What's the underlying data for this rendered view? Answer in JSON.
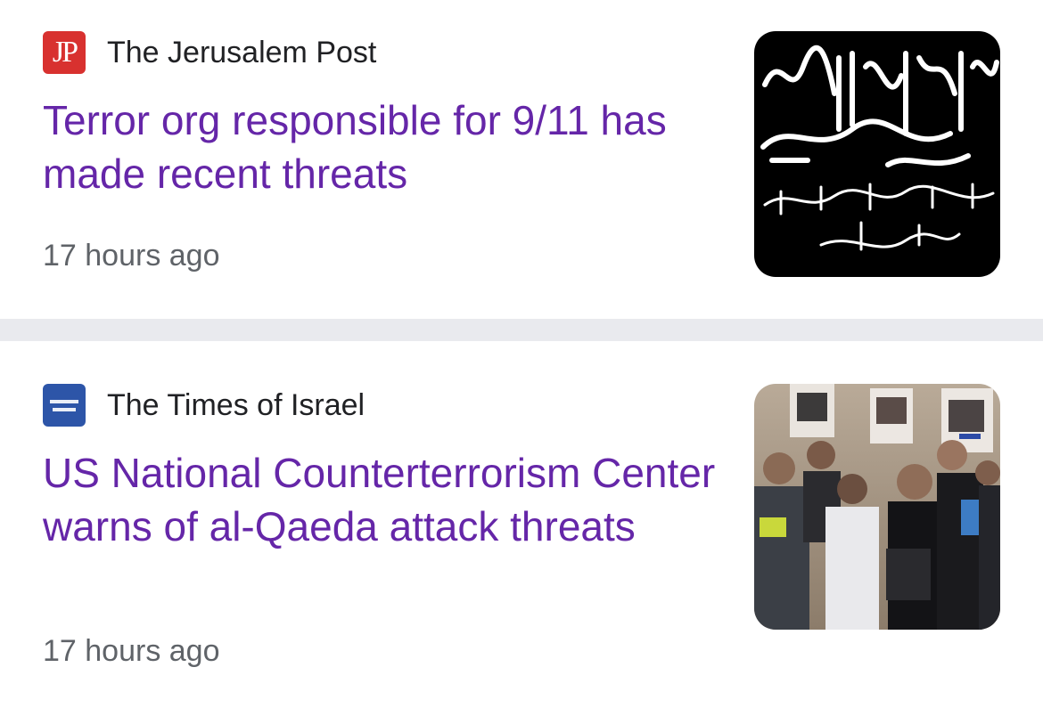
{
  "articles": [
    {
      "source": "The Jerusalem Post",
      "source_logo_text": "JP",
      "source_logo_color": "#d8312f",
      "headline": "Terror org responsible for 9/11 has made recent threats",
      "time": "17 hours ago",
      "thumbnail": "black-banner-arabic-script"
    },
    {
      "source": "The Times of Israel",
      "source_logo_color": "#2d55a8",
      "headline": "US National Counterterrorism Center warns of al-Qaeda attack threats",
      "time": "17 hours ago",
      "thumbnail": "protest-group-photo"
    }
  ],
  "colors": {
    "headline": "#6526a8",
    "divider": "#e9eaee",
    "meta_text": "#5f6368"
  }
}
